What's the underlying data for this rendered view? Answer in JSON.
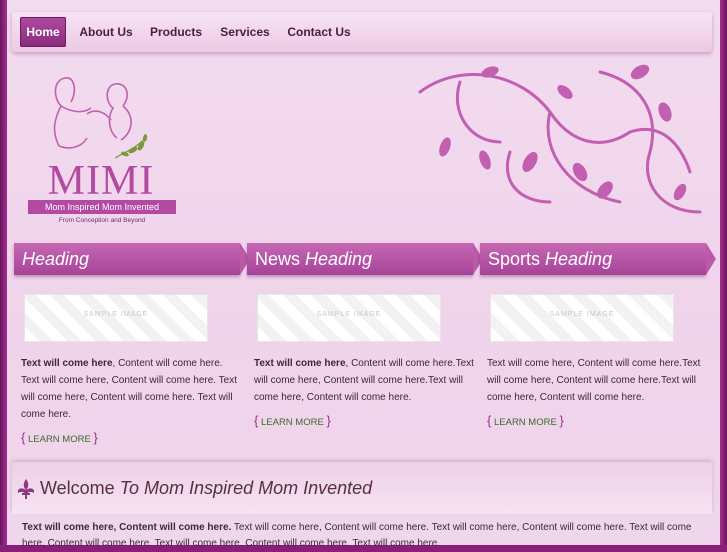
{
  "nav": {
    "items": [
      {
        "label": "Home",
        "active": true
      },
      {
        "label": "About Us"
      },
      {
        "label": "Products"
      },
      {
        "label": "Services"
      },
      {
        "label": "Contact Us"
      }
    ]
  },
  "logo": {
    "title": "MIMI",
    "tagline": "Mom Inspired Mom Invented",
    "subline": "From Conception and Beyond"
  },
  "columns": [
    {
      "heading_plain": "",
      "heading_em": "Heading",
      "image_label": "SAMPLE IMAGE",
      "bold": "Text will come here",
      "text": ", Content will come here. Text will come here, Content will come here. Text will come here, Content will come here. Text will come here.",
      "learn": "LEARN MORE"
    },
    {
      "heading_plain": "News ",
      "heading_em": "Heading",
      "image_label": "SAMPLE IMAGE",
      "bold": "Text will come here",
      "text": ", Content will come here.Text will come here, Content will come here.Text will come here, Content will come here.",
      "learn": "LEARN MORE"
    },
    {
      "heading_plain": "Sports ",
      "heading_em": "Heading",
      "image_label": "SAMPLE IMAGE",
      "bold": "",
      "text": "Text will come here, Content will come here.Text will come here, Content will come here.Text will come here, Content will come here.",
      "learn": "LEARN MORE"
    }
  ],
  "welcome": {
    "plain": "Welcome ",
    "em": "To Mom Inspired Mom Invented",
    "bold": "Text will come here, Content will come here.",
    "text": " Text will come here, Content will come here. Text will come here, Content will come here. Text will come here, Content will come here. Text will come here, Content will come here. Text will come here."
  },
  "colors": {
    "accent": "#b34aa1",
    "nav_active": "#9a3a8c",
    "link": "#3b6b2b"
  }
}
